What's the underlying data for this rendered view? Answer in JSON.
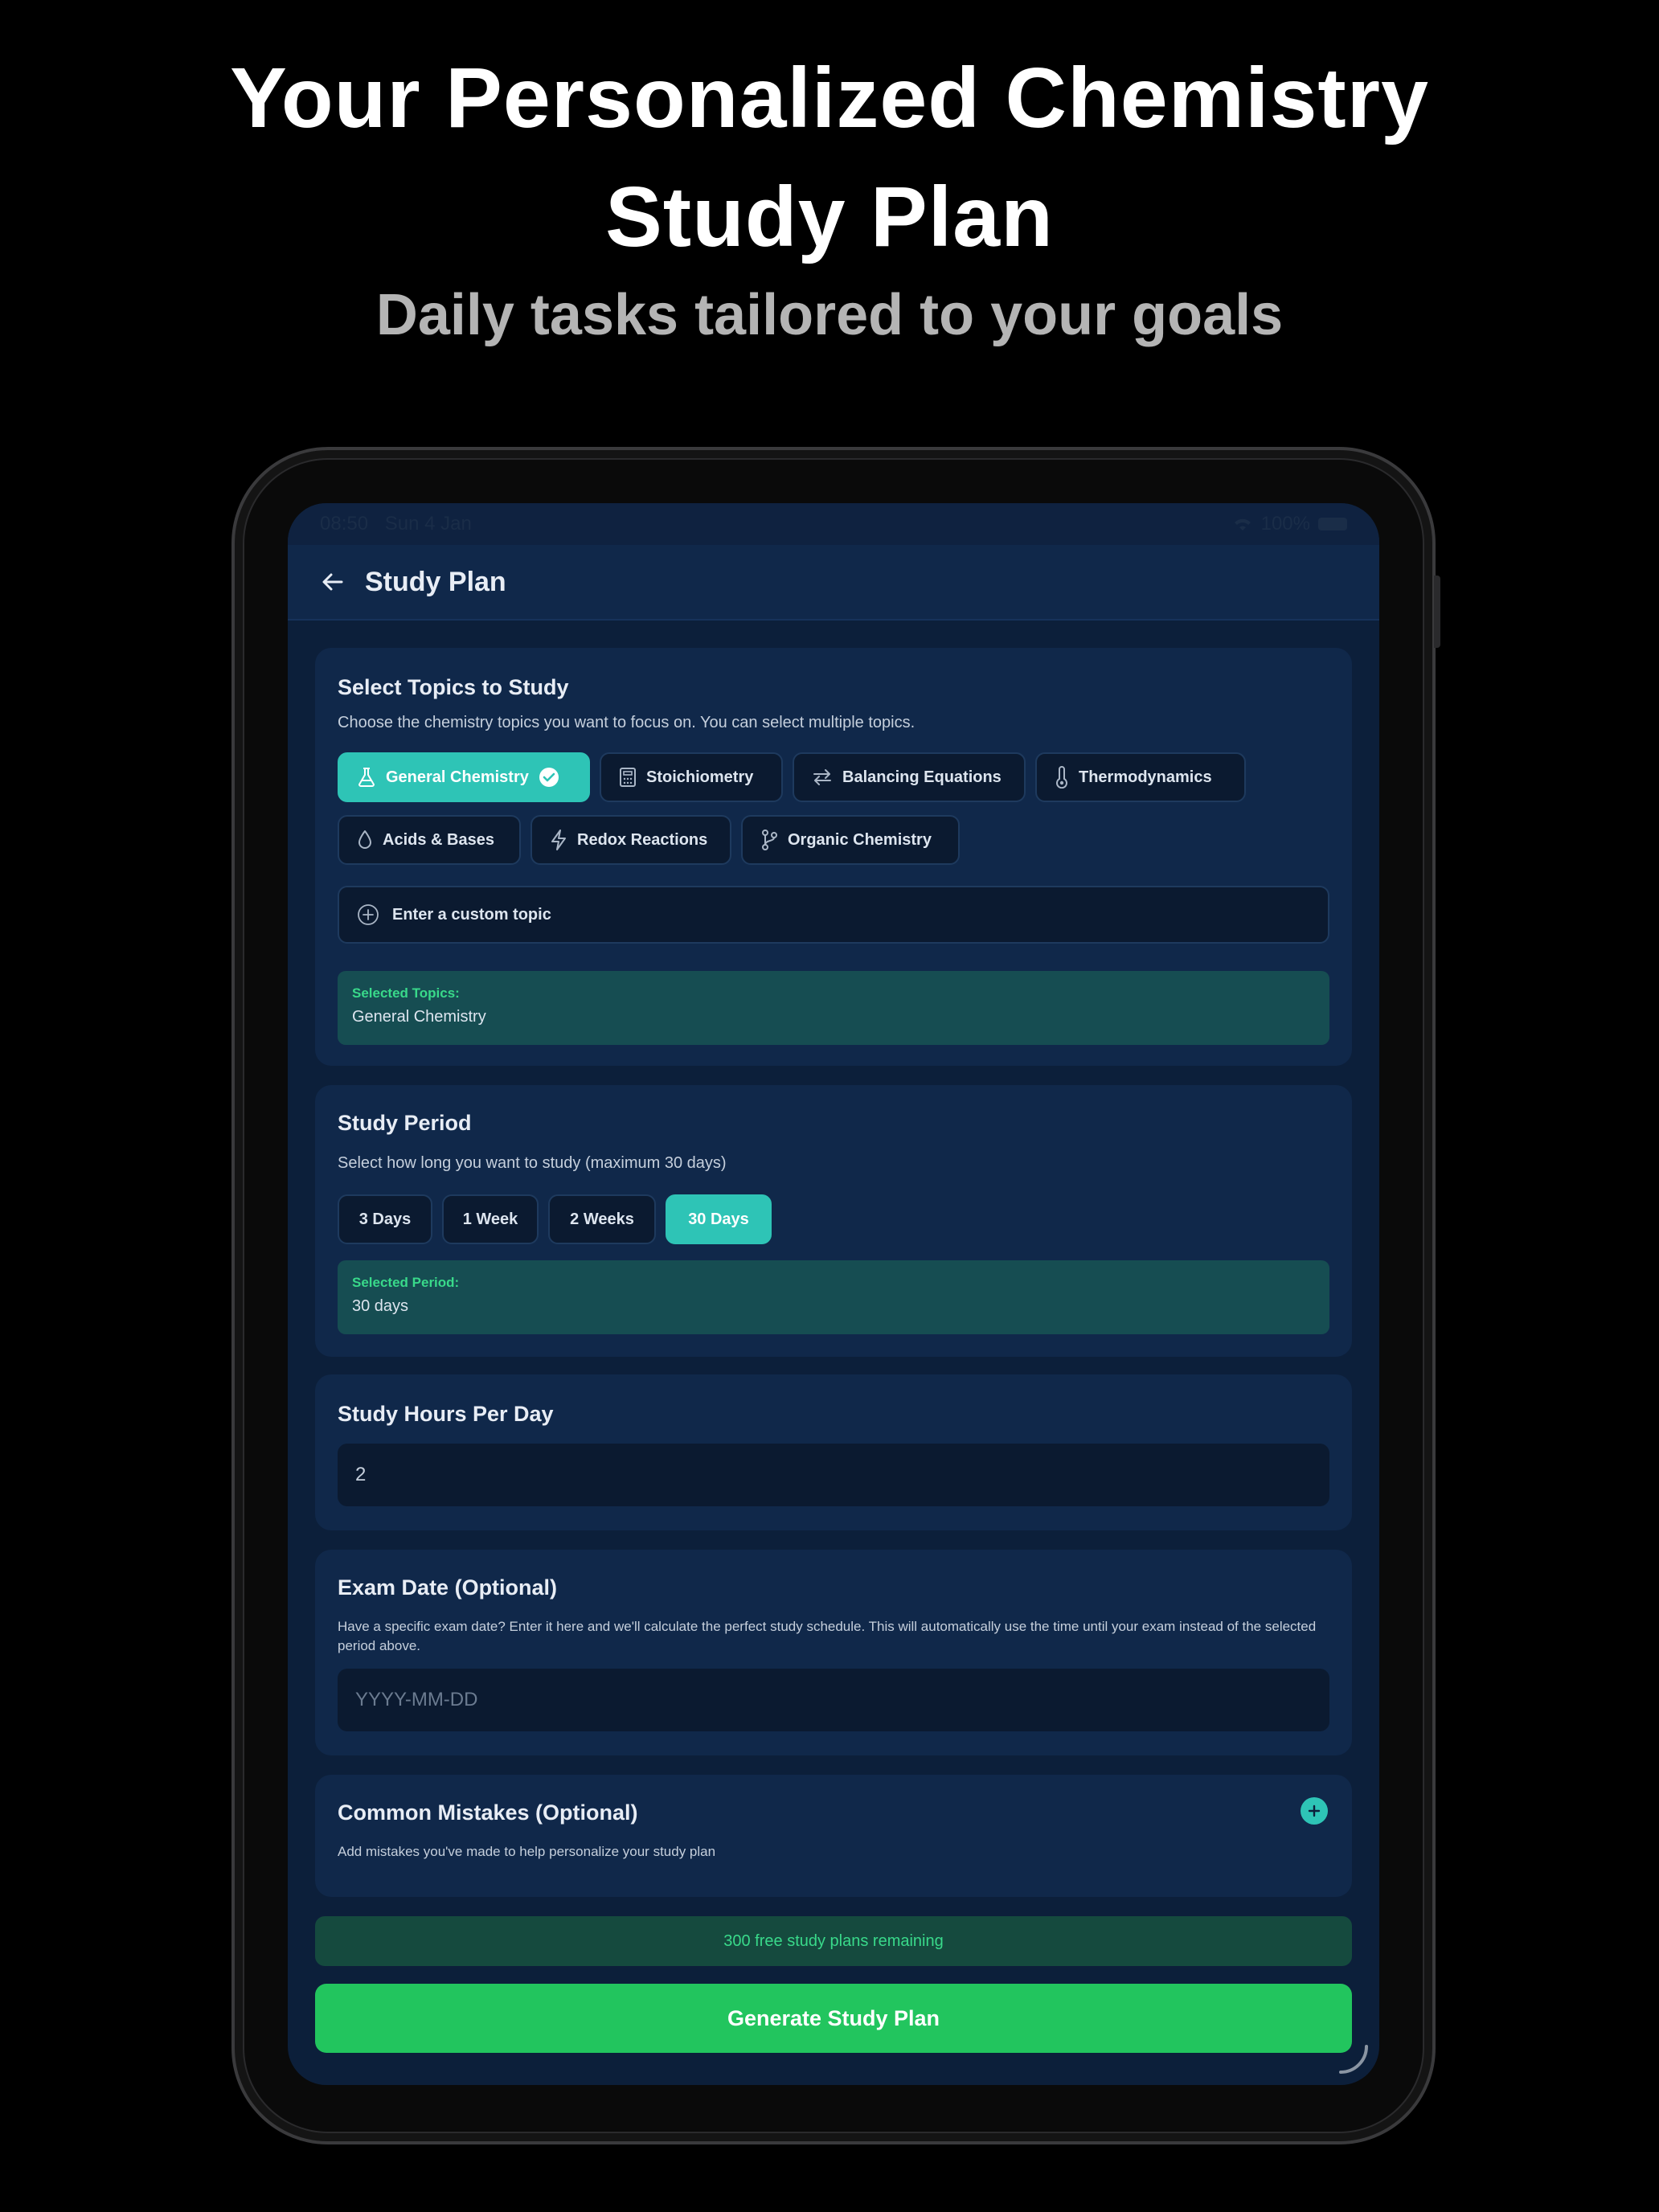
{
  "promo": {
    "headline_line1": "Your Personalized Chemistry",
    "headline_line2": "Study Plan",
    "subheadline": "Daily tasks tailored to your goals"
  },
  "status_bar": {
    "time": "08:50",
    "date": "Sun 4 Jan",
    "battery": "100%"
  },
  "nav": {
    "title": "Study Plan",
    "back_icon": "arrow-left-icon"
  },
  "topics": {
    "title": "Select Topics to Study",
    "description": "Choose the chemistry topics you want to focus on. You can select multiple topics.",
    "chips": [
      {
        "label": "General Chemistry",
        "icon": "flask-icon",
        "selected": true
      },
      {
        "label": "Stoichiometry",
        "icon": "calculator-icon",
        "selected": false
      },
      {
        "label": "Balancing Equations",
        "icon": "arrows-exchange-icon",
        "selected": false
      },
      {
        "label": "Thermodynamics",
        "icon": "thermometer-icon",
        "selected": false
      },
      {
        "label": "Acids & Bases",
        "icon": "droplet-icon",
        "selected": false
      },
      {
        "label": "Redox Reactions",
        "icon": "lightning-icon",
        "selected": false
      },
      {
        "label": "Organic Chemistry",
        "icon": "git-branch-icon",
        "selected": false
      }
    ],
    "custom_topic_placeholder": "Enter a custom topic",
    "selected_label": "Selected Topics:",
    "selected_value": "General Chemistry"
  },
  "period": {
    "title": "Study Period",
    "description": "Select how long you want to study (maximum 30 days)",
    "options": [
      {
        "label": "3 Days",
        "selected": false
      },
      {
        "label": "1 Week",
        "selected": false
      },
      {
        "label": "2 Weeks",
        "selected": false
      },
      {
        "label": "30 Days",
        "selected": true
      }
    ],
    "selected_label": "Selected Period:",
    "selected_value": "30 days"
  },
  "hours": {
    "title": "Study Hours Per Day",
    "value": "2"
  },
  "exam": {
    "title": "Exam Date (Optional)",
    "description": "Have a specific exam date? Enter it here and we'll calculate the perfect study schedule. This will automatically use the time until your exam instead of the selected period above.",
    "placeholder": "YYYY-MM-DD"
  },
  "mistakes": {
    "title": "Common Mistakes (Optional)",
    "description": "Add mistakes you've made to help personalize your study plan"
  },
  "footer": {
    "remaining": "300 free study plans remaining",
    "generate_label": "Generate Study Plan"
  },
  "colors": {
    "accent_teal": "#2ec4b6",
    "accent_green": "#22c55e",
    "card_bg": "#10284a",
    "screen_bg": "#0c1f3a"
  }
}
